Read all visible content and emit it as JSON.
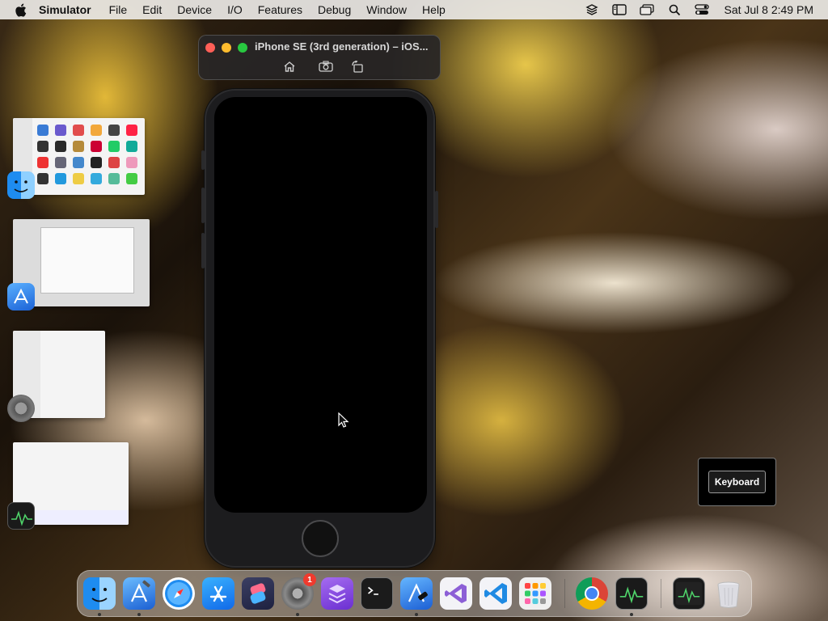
{
  "menubar": {
    "app_name": "Simulator",
    "items": [
      "File",
      "Edit",
      "Device",
      "I/O",
      "Features",
      "Debug",
      "Window",
      "Help"
    ],
    "clock": "Sat Jul 8  2:49 PM",
    "status_icons": [
      "stacks-icon",
      "sidebar-icon",
      "window-stack-icon",
      "search-icon",
      "control-center-icon"
    ]
  },
  "simulator": {
    "title": "iPhone SE (3rd generation) – iOS...",
    "toolbar_buttons": [
      "home-icon",
      "screenshot-icon",
      "rotate-icon"
    ]
  },
  "keyboard_hud": {
    "button_label": "Keyboard"
  },
  "stage_manager": {
    "windows": [
      "finder-window",
      "xcode-window",
      "system-settings-window",
      "activity-monitor-window"
    ]
  },
  "dock": {
    "system_settings_badge": "1",
    "apps": [
      "Finder",
      "Xcode",
      "Safari",
      "App Store",
      "Shortcuts",
      "System Settings",
      "Simulator",
      "Terminal",
      "Instruments",
      "Visual Studio",
      "Visual Studio Code",
      "Launchpad",
      "Google Chrome",
      "Activity Monitor",
      "Activity Monitor",
      "Trash"
    ]
  },
  "colors": {
    "traffic_red": "#ff5f57",
    "traffic_yellow": "#febc2e",
    "traffic_green": "#28c840",
    "badge_red": "#f03a2e"
  }
}
